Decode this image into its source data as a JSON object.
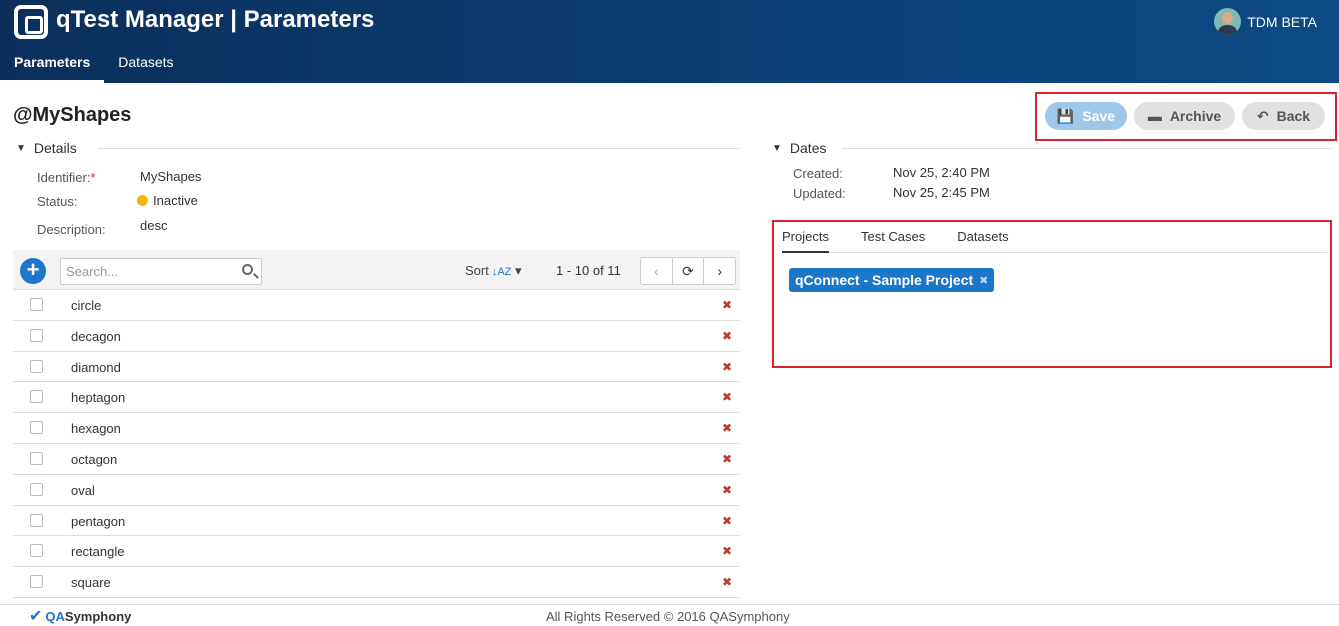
{
  "header": {
    "app_title": "qTest Manager | Parameters",
    "user_name": "TDM BETA",
    "tabs": [
      {
        "label": "Parameters",
        "active": true
      },
      {
        "label": "Datasets",
        "active": false
      }
    ]
  },
  "page": {
    "title": "@MyShapes"
  },
  "actions": {
    "save": "Save",
    "archive": "Archive",
    "back": "Back"
  },
  "details": {
    "heading": "Details",
    "identifier_label": "Identifier:",
    "identifier_required": "*",
    "identifier_value": "MyShapes",
    "status_label": "Status:",
    "status_value": "Inactive",
    "status_color": "#f5b800",
    "description_label": "Description:",
    "description_value": "desc"
  },
  "dates": {
    "heading": "Dates",
    "created_label": "Created:",
    "created_value": "Nov 25, 2:40 PM",
    "updated_label": "Updated:",
    "updated_value": "Nov 25, 2:45 PM"
  },
  "list": {
    "search_placeholder": "Search...",
    "sort_label": "Sort",
    "pager_text": "1 - 10 of 11",
    "items": [
      "circle",
      "decagon",
      "diamond",
      "heptagon",
      "hexagon",
      "octagon",
      "oval",
      "pentagon",
      "rectangle",
      "square"
    ]
  },
  "panel": {
    "tabs": [
      {
        "label": "Projects",
        "active": true
      },
      {
        "label": "Test Cases",
        "active": false
      },
      {
        "label": "Datasets",
        "active": false
      }
    ],
    "chip": "qConnect - Sample Project"
  },
  "footer": {
    "logo_prefix": "QA",
    "logo_suffix": "Symphony",
    "copyright": "All Rights Reserved © 2016 QASymphony"
  },
  "colors": {
    "header_bg": "#0d4a86",
    "accent": "#1d77c9",
    "highlight_border": "#d9232e"
  }
}
